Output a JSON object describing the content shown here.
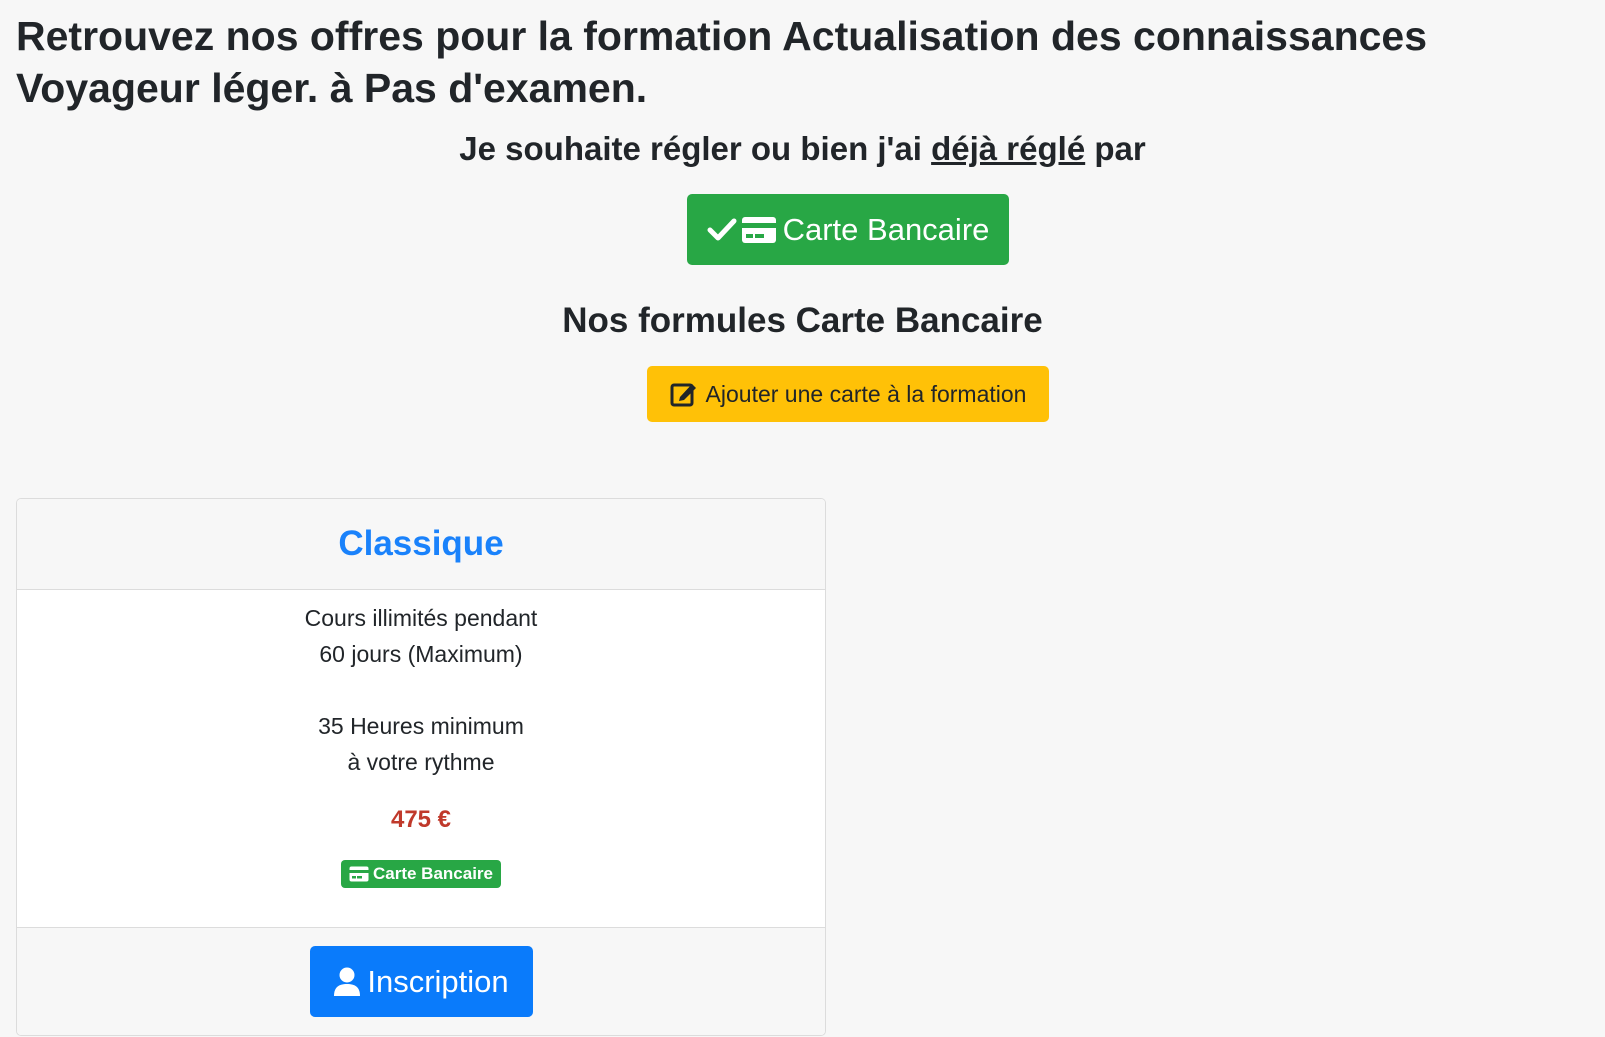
{
  "heading": {
    "title": "Retrouvez nos offres pour la formation Actualisation des connaissances Voyageur léger. à Pas d'examen."
  },
  "payment": {
    "question_prefix": "Je souhaite régler ou bien j'ai",
    "question_underlined": "déjà réglé",
    "question_suffix": "par",
    "method_button_label": "Carte Bancaire",
    "method_icons": [
      "check-icon",
      "credit-card-icon"
    ]
  },
  "formules": {
    "title": "Nos formules Carte Bancaire",
    "add_button_label": "Ajouter une carte à la formation",
    "add_button_icon": "edit-icon"
  },
  "offer": {
    "title": "Classique",
    "lines": [
      "Cours illimités pendant",
      "60 jours (Maximum)",
      "35 Heures minimum",
      "à votre rythme"
    ],
    "price": "475 €",
    "badge_label": "Carte Bancaire",
    "badge_icon": "credit-card-icon",
    "cta_label": "Inscription",
    "cta_icon": "user-icon"
  },
  "colors": {
    "background": "#f7f7f7",
    "success": "#28a745",
    "warning": "#ffc107",
    "primary": "#0a7bfb",
    "card_title": "#1a82fb",
    "price": "#c0392b",
    "text": "#212529"
  }
}
